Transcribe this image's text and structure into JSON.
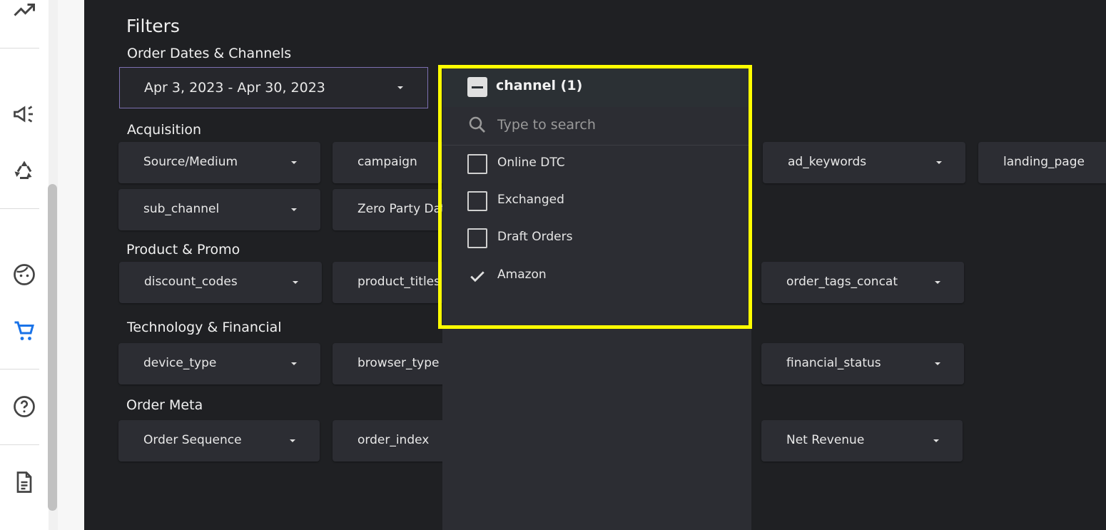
{
  "page": {
    "title": "Filters"
  },
  "sections": {
    "order_dates": "Order Dates & Channels",
    "acquisition": "Acquisition",
    "product_promo": "Product & Promo",
    "technology_financial": "Technology & Financial",
    "order_meta": "Order Meta"
  },
  "date_range": {
    "value": "Apr 3, 2023 - Apr 30, 2023"
  },
  "filters": {
    "source_medium": "Source/Medium",
    "campaign": "campaign",
    "ad_keywords": "ad_keywords",
    "landing_page": "landing_page",
    "sub_channel": "sub_channel",
    "zero_party_data": "Zero Party Dat",
    "discount_codes": "discount_codes",
    "product_titles": "product_titles",
    "order_tags_concat": "order_tags_concat",
    "device_type": "device_type",
    "browser_type": "browser_type",
    "financial_status": "financial_status",
    "order_sequence": "Order Sequence",
    "order_index": "order_index",
    "net_revenue": "Net Revenue"
  },
  "dropdown": {
    "title": "channel (1)",
    "search_placeholder": "Type to search",
    "options": [
      {
        "label": "Online DTC",
        "checked": false
      },
      {
        "label": "Exchanged",
        "checked": false
      },
      {
        "label": "Draft Orders",
        "checked": false
      },
      {
        "label": "Amazon",
        "checked": true
      }
    ]
  },
  "colors": {
    "panel_background": "#1f2023",
    "button_background": "#2c2d33",
    "highlight": "#ffff00",
    "active_nav": "#1a73e8"
  },
  "sidebar_icons": [
    "trending-up-icon",
    "megaphone-icon",
    "recycle-icon",
    "face-icon",
    "cart-icon",
    "help-icon",
    "document-icon"
  ]
}
